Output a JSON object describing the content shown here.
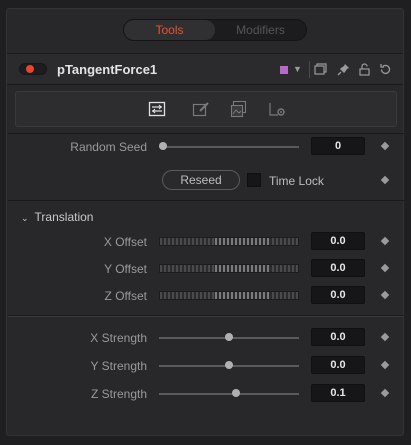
{
  "top_tabs": {
    "tools": "Tools",
    "modifiers": "Modifiers"
  },
  "header": {
    "title": "pTangentForce1",
    "color_swatch": "#b569c8",
    "icons": [
      "chevron-down-icon",
      "copy-icon",
      "pin-icon",
      "lock-icon",
      "reset-icon"
    ]
  },
  "tab_icons": [
    "controls-tab-icon",
    "style-tab-icon",
    "image-tab-icon",
    "settings-tab-icon"
  ],
  "random_seed": {
    "label": "Random Seed",
    "value": "0",
    "slider_fraction": 0.0
  },
  "reseed": {
    "label": "Reseed"
  },
  "time_lock": {
    "label": "Time Lock",
    "checked": false
  },
  "translation": {
    "section_label": "Translation",
    "rows": [
      {
        "label": "X Offset",
        "value": "0.0"
      },
      {
        "label": "Y Offset",
        "value": "0.0"
      },
      {
        "label": "Z Offset",
        "value": "0.0"
      }
    ]
  },
  "strength": {
    "rows": [
      {
        "label": "X Strength",
        "value": "0.0",
        "slider_fraction": 0.5
      },
      {
        "label": "Y Strength",
        "value": "0.0",
        "slider_fraction": 0.5
      },
      {
        "label": "Z Strength",
        "value": "0.1",
        "slider_fraction": 0.55
      }
    ]
  },
  "colors": {
    "accent": "#e6532e",
    "enabled_dot": "#e8452a"
  }
}
